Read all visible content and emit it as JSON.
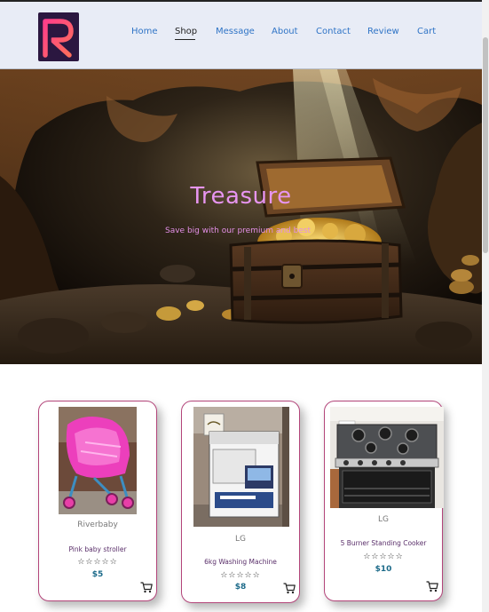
{
  "nav": {
    "items": [
      {
        "label": "Home"
      },
      {
        "label": "Shop"
      },
      {
        "label": "Message"
      },
      {
        "label": "About"
      },
      {
        "label": "Contact"
      },
      {
        "label": "Review"
      },
      {
        "label": "Cart"
      }
    ],
    "active_index": 1
  },
  "logo": {
    "letter": "R",
    "icon": "r-logo-icon"
  },
  "hero": {
    "title": "Treasure",
    "subtitle": "Save big with our premium and best"
  },
  "products": [
    {
      "brand": "Riverbaby",
      "name": "Pink baby stroller",
      "rating": 0,
      "stars": "☆☆☆☆☆",
      "price": "$5",
      "icon": "cart-icon"
    },
    {
      "brand": "LG",
      "name": "6kg Washing Machine",
      "rating": 0,
      "stars": "☆☆☆☆☆",
      "price": "$8",
      "icon": "cart-icon"
    },
    {
      "brand": "LG",
      "name": "5 Burner Standing Cooker",
      "rating": 0,
      "stars": "☆☆☆☆☆",
      "price": "$10",
      "icon": "cart-icon"
    }
  ],
  "colors": {
    "nav_link": "#2f74c6",
    "hero_text": "#e795f0",
    "card_border": "#b3457a",
    "price": "#1d6b8a"
  }
}
